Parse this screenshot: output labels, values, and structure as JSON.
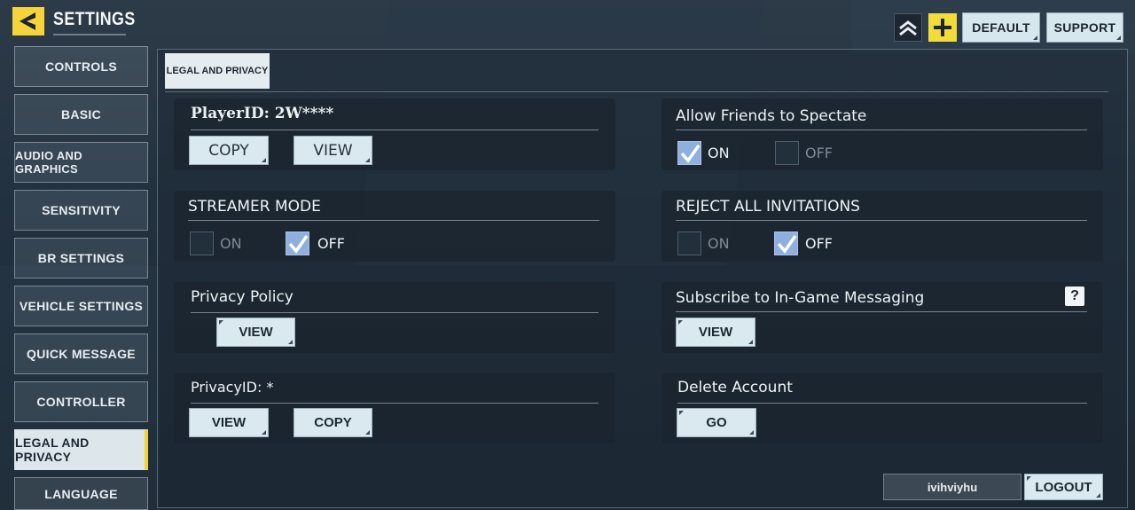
{
  "header": {
    "title": "SETTINGS",
    "default_label": "DEFAULT",
    "support_label": "SUPPORT",
    "icons": [
      "back-arrow-icon",
      "rank-chevron-icon",
      "plus-icon"
    ]
  },
  "sidebar": {
    "items": [
      {
        "label": "CONTROLS"
      },
      {
        "label": "BASIC"
      },
      {
        "label": "AUDIO AND GRAPHICS"
      },
      {
        "label": "SENSITIVITY"
      },
      {
        "label": "BR SETTINGS"
      },
      {
        "label": "VEHICLE SETTINGS"
      },
      {
        "label": "QUICK MESSAGE"
      },
      {
        "label": "CONTROLLER"
      },
      {
        "label": "LEGAL AND PRIVACY"
      },
      {
        "label": "LANGUAGE"
      }
    ],
    "active": "LEGAL AND PRIVACY"
  },
  "tab": {
    "label": "LEGAL AND PRIVACY"
  },
  "player_id": {
    "title": "PlayerID: 2W****",
    "copy_label": "COPY",
    "view_label": "VIEW"
  },
  "streamer_mode": {
    "title": "STREAMER MODE",
    "on_label": "ON",
    "off_label": "OFF",
    "selected": "OFF"
  },
  "privacy_policy": {
    "title": "Privacy Policy",
    "view_label": "VIEW"
  },
  "privacy_id": {
    "title": "PrivacyID: *",
    "view_label": "VIEW",
    "copy_label": "COPY"
  },
  "spectate": {
    "title": "Allow Friends to Spectate",
    "on_label": "ON",
    "off_label": "OFF",
    "selected": "ON"
  },
  "reject_invitations": {
    "title": "REJECT ALL INVITATIONS",
    "on_label": "ON",
    "off_label": "OFF",
    "selected": "OFF"
  },
  "messaging": {
    "title": "Subscribe to In-Game Messaging",
    "help": "?",
    "view_label": "VIEW"
  },
  "delete_account": {
    "title": "Delete Account",
    "go_label": "GO"
  },
  "account": {
    "username": "ivihviyhu",
    "logout_label": "LOGOUT"
  },
  "colors": {
    "accent": "#f2d33c",
    "button_bg": "#d9e9ef",
    "checkbox_on": "#8fb0de"
  }
}
